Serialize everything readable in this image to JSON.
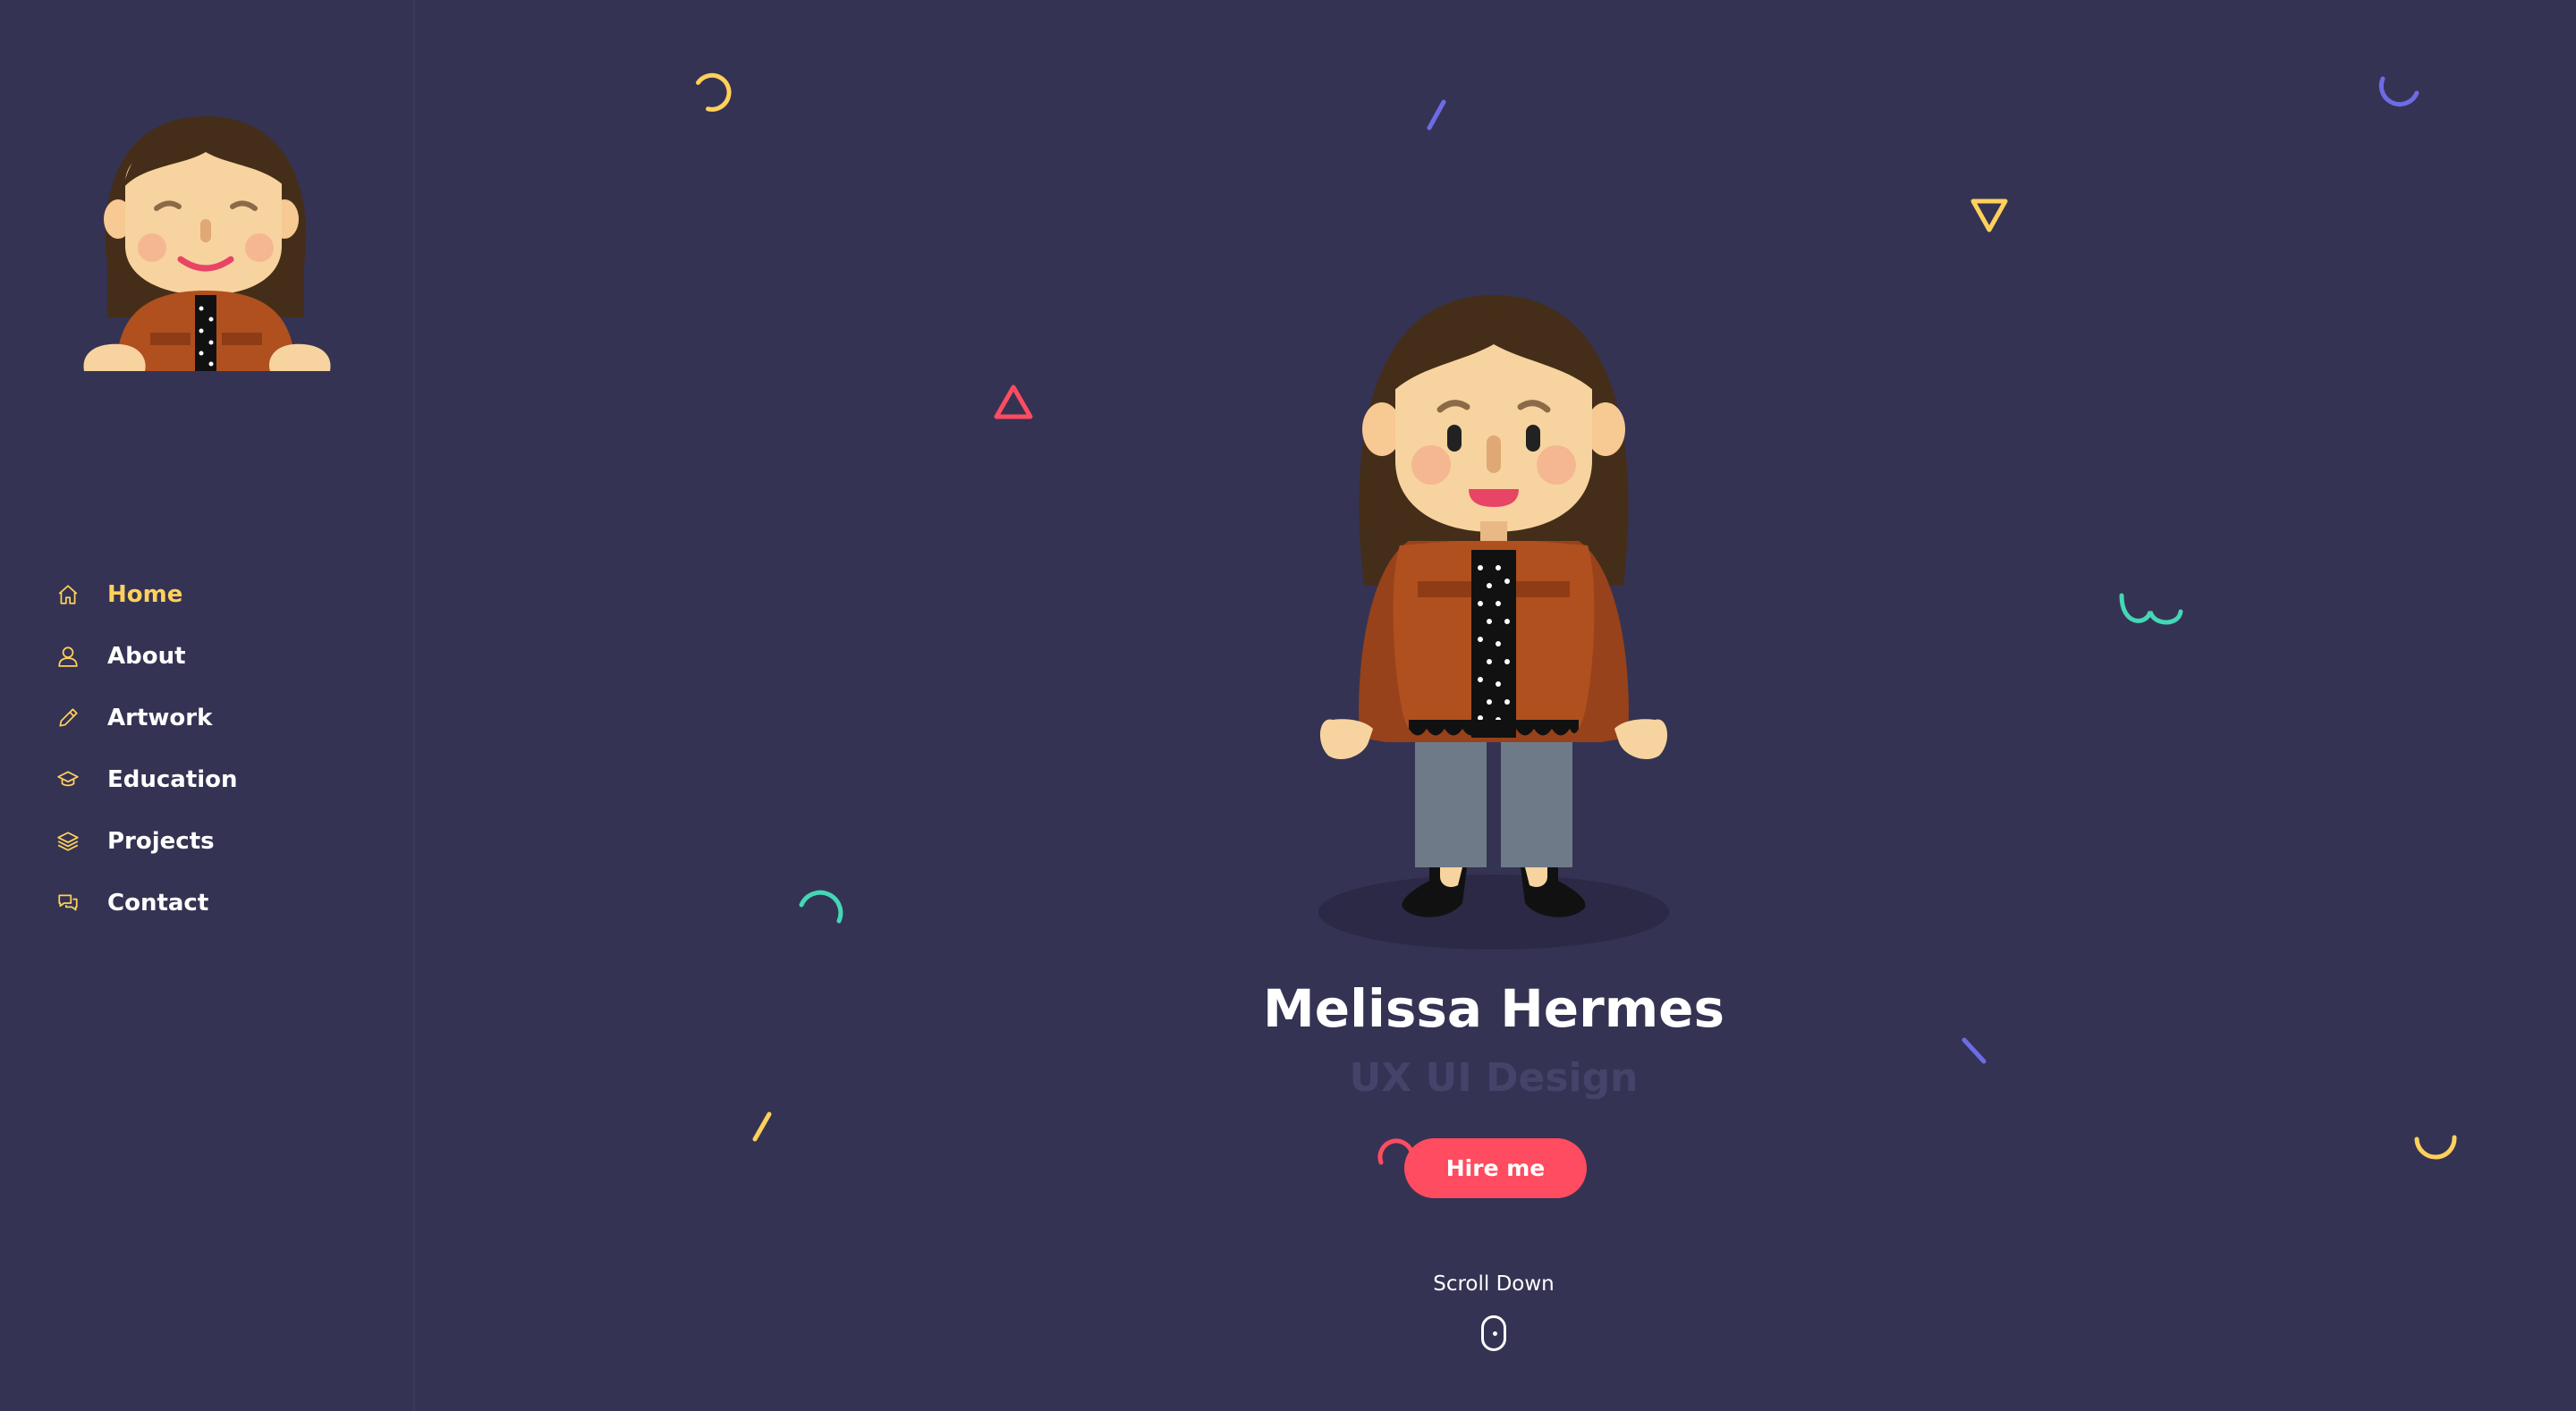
{
  "sidebar": {
    "nav": [
      {
        "label": "Home",
        "icon": "home-icon",
        "active": true
      },
      {
        "label": "About",
        "icon": "user-icon",
        "active": false
      },
      {
        "label": "Artwork",
        "icon": "pencil-icon",
        "active": false
      },
      {
        "label": "Education",
        "icon": "graduation-cap-icon",
        "active": false
      },
      {
        "label": "Projects",
        "icon": "layers-icon",
        "active": false
      },
      {
        "label": "Contact",
        "icon": "chat-bubbles-icon",
        "active": false
      }
    ]
  },
  "hero": {
    "name": "Melissa Hermes",
    "role": "UX UI Design",
    "hire_label": "Hire me",
    "scroll_label": "Scroll Down"
  },
  "colors": {
    "background": "#353353",
    "accent_yellow": "#ffd15c",
    "accent_red": "#ff4c60",
    "accent_blue": "#6c6ce5",
    "accent_teal": "#44d7b6"
  }
}
